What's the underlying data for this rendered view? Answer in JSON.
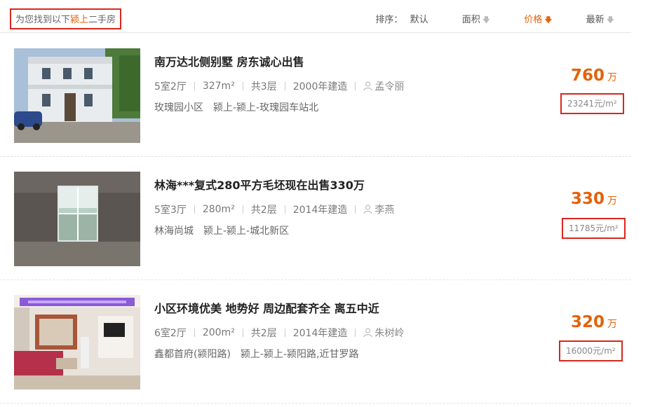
{
  "header": {
    "found_prefix": "为您找到以下",
    "found_city": "颍上",
    "found_suffix": "二手房",
    "sort_label": "排序：",
    "sort_default": "默认",
    "sort_area": "面积",
    "sort_price": "价格",
    "sort_newest": "最新"
  },
  "listings": [
    {
      "title": "南万达北侧别墅 房东诚心出售",
      "rooms": "5室2厅",
      "area": "327m²",
      "floors": "共3层",
      "built": "2000年建造",
      "agent": "孟令丽",
      "community": "玫瑰园小区",
      "location": "颍上-颍上-玫瑰园车站北",
      "price": "760",
      "price_unit": "万",
      "unit_price": "23241元/m²"
    },
    {
      "title": "林海***复式280平方毛坯现在出售330万",
      "rooms": "5室3厅",
      "area": "280m²",
      "floors": "共2层",
      "built": "2014年建造",
      "agent": "李燕",
      "community": "林海尚城",
      "location": "颍上-颍上-城北新区",
      "price": "330",
      "price_unit": "万",
      "unit_price": "11785元/m²"
    },
    {
      "title": "小区环境优美 地势好 周边配套齐全 离五中近",
      "rooms": "6室2厅",
      "area": "200m²",
      "floors": "共2层",
      "built": "2014年建造",
      "agent": "朱树岭",
      "community": "鑫都首府(颍阳路)",
      "location": "颍上-颍上-颍阳路,近甘罗路",
      "price": "320",
      "price_unit": "万",
      "unit_price": "16000元/m²"
    }
  ],
  "icons": {
    "sort_arrow": "down-arrow-icon",
    "agent": "person-icon"
  },
  "colors": {
    "accent": "#e4620a",
    "highlight_border": "#d9261c"
  }
}
